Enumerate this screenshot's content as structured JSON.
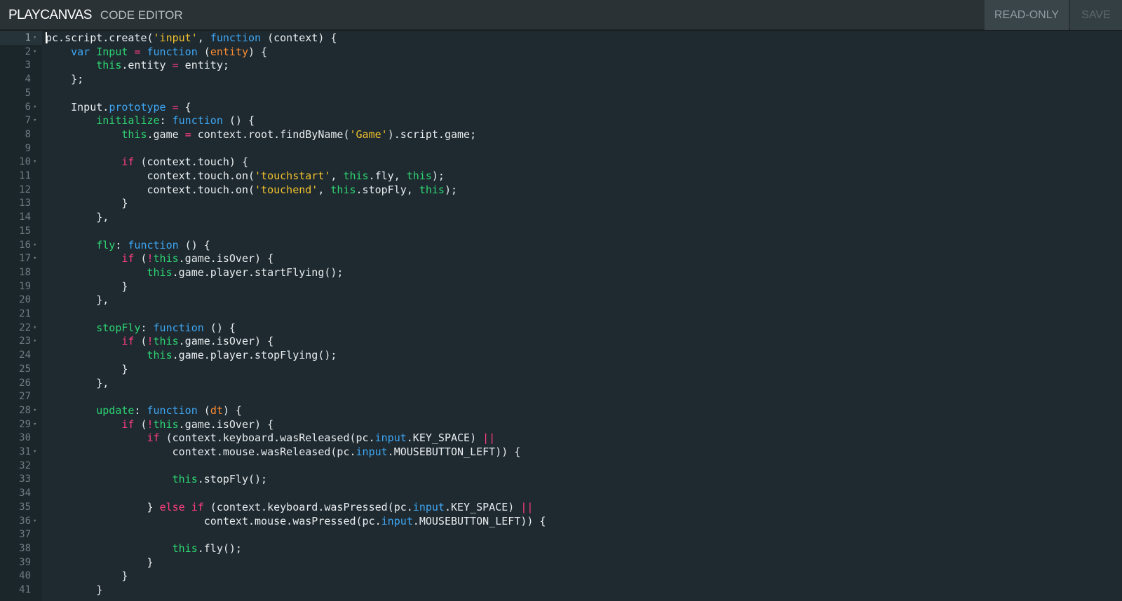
{
  "header": {
    "brand_play": "PLAY",
    "brand_canvas": "CANVAS",
    "brand_sub": "CODE EDITOR",
    "readonly_label": "READ-ONLY",
    "save_label": "SAVE"
  },
  "editor": {
    "current_line": 1,
    "lines": [
      {
        "n": "1",
        "fold": true,
        "tokens": [
          [
            "",
            "pc.script.create("
          ],
          [
            "str",
            "'input'"
          ],
          [
            "",
            ", "
          ],
          [
            "kw",
            "function"
          ],
          [
            "",
            " (context) {"
          ]
        ]
      },
      {
        "n": "2",
        "fold": true,
        "tokens": [
          [
            "",
            "    "
          ],
          [
            "kw",
            "var"
          ],
          [
            "",
            " "
          ],
          [
            "name",
            "Input"
          ],
          [
            "",
            " "
          ],
          [
            "op",
            "="
          ],
          [
            "",
            " "
          ],
          [
            "kw",
            "function"
          ],
          [
            "",
            " ("
          ],
          [
            "param",
            "entity"
          ],
          [
            "",
            ") {"
          ]
        ]
      },
      {
        "n": "3",
        "fold": false,
        "tokens": [
          [
            "",
            "        "
          ],
          [
            "this",
            "this"
          ],
          [
            "",
            ".entity "
          ],
          [
            "op",
            "="
          ],
          [
            "",
            " entity;"
          ]
        ]
      },
      {
        "n": "4",
        "fold": false,
        "tokens": [
          [
            "",
            "    };"
          ]
        ]
      },
      {
        "n": "5",
        "fold": false,
        "tokens": []
      },
      {
        "n": "6",
        "fold": true,
        "tokens": [
          [
            "",
            "    Input."
          ],
          [
            "kw",
            "prototype"
          ],
          [
            "",
            " "
          ],
          [
            "op",
            "="
          ],
          [
            "",
            " {"
          ]
        ]
      },
      {
        "n": "7",
        "fold": true,
        "tokens": [
          [
            "",
            "        "
          ],
          [
            "name",
            "initialize"
          ],
          [
            "",
            ": "
          ],
          [
            "kw",
            "function"
          ],
          [
            "",
            " () {"
          ]
        ]
      },
      {
        "n": "8",
        "fold": false,
        "tokens": [
          [
            "",
            "            "
          ],
          [
            "this",
            "this"
          ],
          [
            "",
            ".game "
          ],
          [
            "op",
            "="
          ],
          [
            "",
            " context.root.findByName("
          ],
          [
            "str",
            "'Game'"
          ],
          [
            "",
            ").script.game;"
          ]
        ]
      },
      {
        "n": "9",
        "fold": false,
        "tokens": []
      },
      {
        "n": "10",
        "fold": true,
        "tokens": [
          [
            "",
            "            "
          ],
          [
            "if",
            "if"
          ],
          [
            "",
            " (context.touch) {"
          ]
        ]
      },
      {
        "n": "11",
        "fold": false,
        "tokens": [
          [
            "",
            "                context.touch.on("
          ],
          [
            "str",
            "'touchstart'"
          ],
          [
            "",
            ", "
          ],
          [
            "this",
            "this"
          ],
          [
            "",
            ".fly, "
          ],
          [
            "this",
            "this"
          ],
          [
            "",
            ");"
          ]
        ]
      },
      {
        "n": "12",
        "fold": false,
        "tokens": [
          [
            "",
            "                context.touch.on("
          ],
          [
            "str",
            "'touchend'"
          ],
          [
            "",
            ", "
          ],
          [
            "this",
            "this"
          ],
          [
            "",
            ".stopFly, "
          ],
          [
            "this",
            "this"
          ],
          [
            "",
            ");"
          ]
        ]
      },
      {
        "n": "13",
        "fold": false,
        "tokens": [
          [
            "",
            "            }"
          ]
        ]
      },
      {
        "n": "14",
        "fold": false,
        "tokens": [
          [
            "",
            "        },"
          ]
        ]
      },
      {
        "n": "15",
        "fold": false,
        "tokens": []
      },
      {
        "n": "16",
        "fold": true,
        "tokens": [
          [
            "",
            "        "
          ],
          [
            "name",
            "fly"
          ],
          [
            "",
            ": "
          ],
          [
            "kw",
            "function"
          ],
          [
            "",
            " () {"
          ]
        ]
      },
      {
        "n": "17",
        "fold": true,
        "tokens": [
          [
            "",
            "            "
          ],
          [
            "if",
            "if"
          ],
          [
            "",
            " ("
          ],
          [
            "op",
            "!"
          ],
          [
            "this",
            "this"
          ],
          [
            "",
            ".game.isOver) {"
          ]
        ]
      },
      {
        "n": "18",
        "fold": false,
        "tokens": [
          [
            "",
            "                "
          ],
          [
            "this",
            "this"
          ],
          [
            "",
            ".game.player.startFlying();"
          ]
        ]
      },
      {
        "n": "19",
        "fold": false,
        "tokens": [
          [
            "",
            "            }"
          ]
        ]
      },
      {
        "n": "20",
        "fold": false,
        "tokens": [
          [
            "",
            "        },"
          ]
        ]
      },
      {
        "n": "21",
        "fold": false,
        "tokens": []
      },
      {
        "n": "22",
        "fold": true,
        "tokens": [
          [
            "",
            "        "
          ],
          [
            "name",
            "stopFly"
          ],
          [
            "",
            ": "
          ],
          [
            "kw",
            "function"
          ],
          [
            "",
            " () {"
          ]
        ]
      },
      {
        "n": "23",
        "fold": true,
        "tokens": [
          [
            "",
            "            "
          ],
          [
            "if",
            "if"
          ],
          [
            "",
            " ("
          ],
          [
            "op",
            "!"
          ],
          [
            "this",
            "this"
          ],
          [
            "",
            ".game.isOver) {"
          ]
        ]
      },
      {
        "n": "24",
        "fold": false,
        "tokens": [
          [
            "",
            "                "
          ],
          [
            "this",
            "this"
          ],
          [
            "",
            ".game.player.stopFlying();"
          ]
        ]
      },
      {
        "n": "25",
        "fold": false,
        "tokens": [
          [
            "",
            "            }"
          ]
        ]
      },
      {
        "n": "26",
        "fold": false,
        "tokens": [
          [
            "",
            "        },"
          ]
        ]
      },
      {
        "n": "27",
        "fold": false,
        "tokens": []
      },
      {
        "n": "28",
        "fold": true,
        "tokens": [
          [
            "",
            "        "
          ],
          [
            "name",
            "update"
          ],
          [
            "",
            ": "
          ],
          [
            "kw",
            "function"
          ],
          [
            "",
            " ("
          ],
          [
            "param",
            "dt"
          ],
          [
            "",
            ") {"
          ]
        ]
      },
      {
        "n": "29",
        "fold": true,
        "tokens": [
          [
            "",
            "            "
          ],
          [
            "if",
            "if"
          ],
          [
            "",
            " ("
          ],
          [
            "op",
            "!"
          ],
          [
            "this",
            "this"
          ],
          [
            "",
            ".game.isOver) {"
          ]
        ]
      },
      {
        "n": "30",
        "fold": false,
        "tokens": [
          [
            "",
            "                "
          ],
          [
            "if",
            "if"
          ],
          [
            "",
            " (context.keyboard.wasReleased(pc."
          ],
          [
            "kw",
            "input"
          ],
          [
            "",
            ".KEY_SPACE) "
          ],
          [
            "op",
            "||"
          ]
        ]
      },
      {
        "n": "31",
        "fold": true,
        "tokens": [
          [
            "",
            "                    context.mouse.wasReleased(pc."
          ],
          [
            "kw",
            "input"
          ],
          [
            "",
            ".MOUSEBUTTON_LEFT)) {"
          ]
        ]
      },
      {
        "n": "32",
        "fold": false,
        "tokens": []
      },
      {
        "n": "33",
        "fold": false,
        "tokens": [
          [
            "",
            "                    "
          ],
          [
            "this",
            "this"
          ],
          [
            "",
            ".stopFly();"
          ]
        ]
      },
      {
        "n": "34",
        "fold": false,
        "tokens": []
      },
      {
        "n": "35",
        "fold": false,
        "tokens": [
          [
            "",
            "                } "
          ],
          [
            "if",
            "else"
          ],
          [
            "",
            " "
          ],
          [
            "if",
            "if"
          ],
          [
            "",
            " (context.keyboard.wasPressed(pc."
          ],
          [
            "kw",
            "input"
          ],
          [
            "",
            ".KEY_SPACE) "
          ],
          [
            "op",
            "||"
          ]
        ]
      },
      {
        "n": "36",
        "fold": true,
        "tokens": [
          [
            "",
            "                         context.mouse.wasPressed(pc."
          ],
          [
            "kw",
            "input"
          ],
          [
            "",
            ".MOUSEBUTTON_LEFT)) {"
          ]
        ]
      },
      {
        "n": "37",
        "fold": false,
        "tokens": []
      },
      {
        "n": "38",
        "fold": false,
        "tokens": [
          [
            "",
            "                    "
          ],
          [
            "this",
            "this"
          ],
          [
            "",
            ".fly();"
          ]
        ]
      },
      {
        "n": "39",
        "fold": false,
        "tokens": [
          [
            "",
            "                }"
          ]
        ]
      },
      {
        "n": "40",
        "fold": false,
        "tokens": [
          [
            "",
            "            }"
          ]
        ]
      },
      {
        "n": "41",
        "fold": false,
        "tokens": [
          [
            "",
            "        }"
          ]
        ]
      }
    ]
  }
}
